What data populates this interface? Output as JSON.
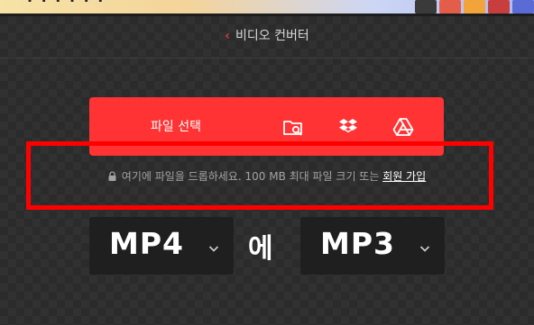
{
  "banner": {
    "text": "· · · · · ·",
    "thumb_colors": [
      "#3a3a3a",
      "#e45c4a",
      "#f2a33a",
      "#c83e3e",
      "#5a6bd6"
    ]
  },
  "breadcrumb": {
    "back_icon": "chevron-left-icon",
    "title": "비디오 컨버터"
  },
  "upload": {
    "label": "파일 선택",
    "sources": [
      {
        "name": "folder-search-icon"
      },
      {
        "name": "dropbox-icon"
      },
      {
        "name": "google-drive-icon"
      }
    ]
  },
  "dropzone": {
    "text": "여기에 파일을 드롭하세요. 100 MB 최대 파일 크기 또는",
    "link": "회원 가입",
    "icon": "lock-icon"
  },
  "conversion": {
    "from_format": "MP4",
    "connector": "에",
    "to_format": "MP3"
  },
  "colors": {
    "accent": "#ff3334",
    "highlight": "#ff0000",
    "background": "#2b2b2b",
    "select_bg": "#1f1f1f"
  }
}
